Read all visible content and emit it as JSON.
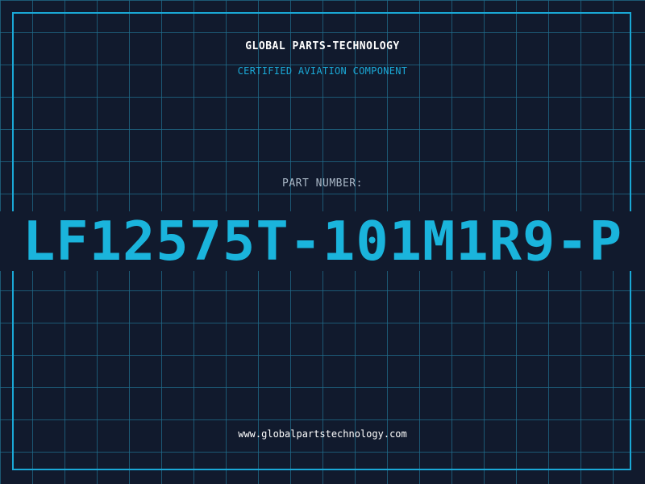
{
  "header": {
    "title": "GLOBAL PARTS-TECHNOLOGY",
    "subtitle": "CERTIFIED AVIATION COMPONENT"
  },
  "part": {
    "label": "PART NUMBER:",
    "number": "LF12575T-101M1R9-P"
  },
  "footer": {
    "url": "www.globalpartstechnology.com"
  },
  "colors": {
    "background": "#111a2d",
    "grid": "#206c8c",
    "accent": "#1ab4dc",
    "text": "#ffffff",
    "label": "#a9b7c6"
  }
}
